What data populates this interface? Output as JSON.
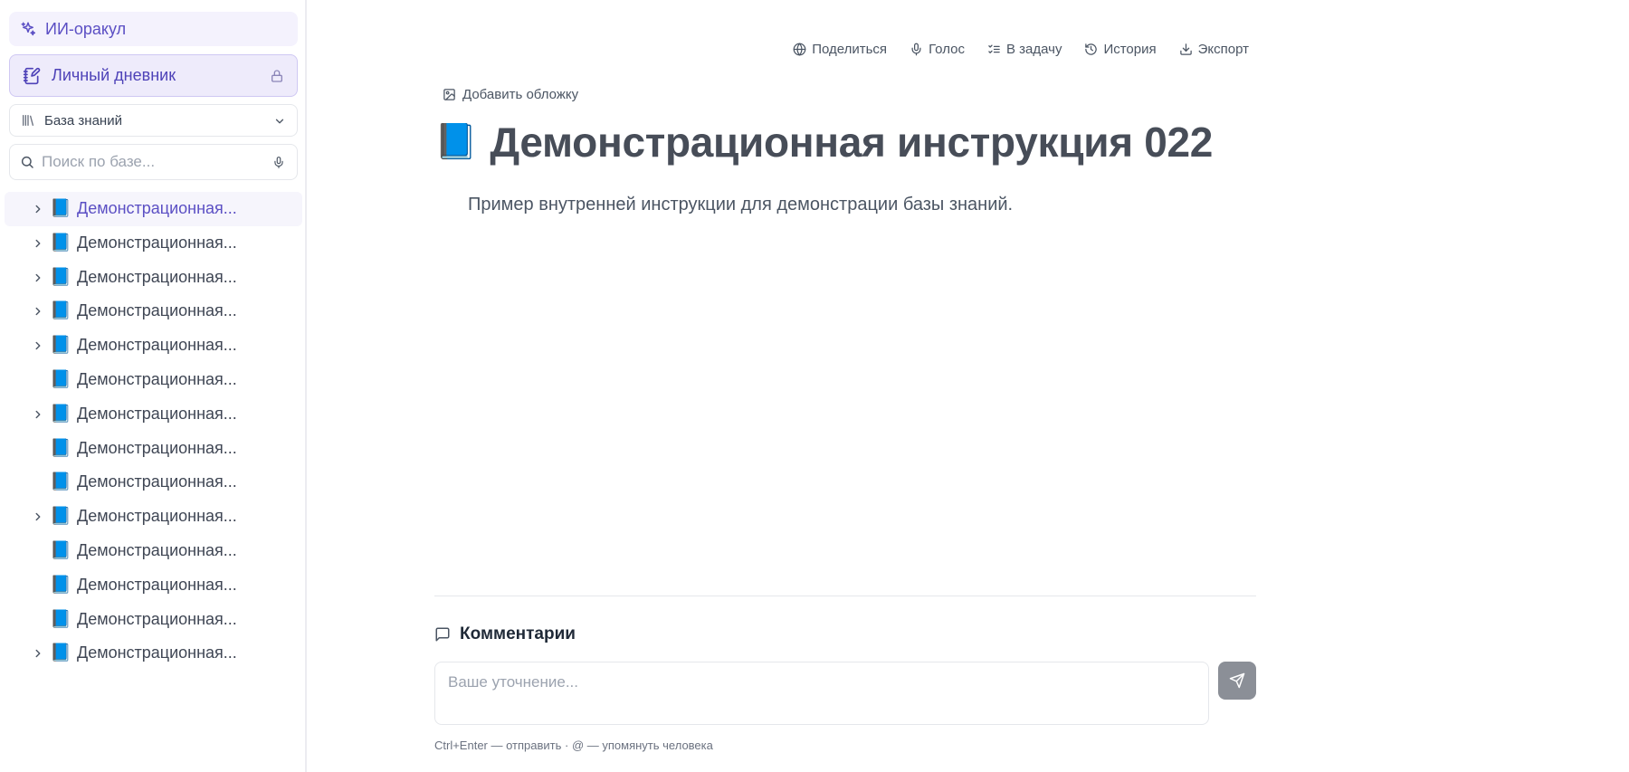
{
  "sidebar": {
    "oracle_label": "ИИ-оракул",
    "diary_label": "Личный дневник",
    "kb_select": "База знаний",
    "search_placeholder": "Поиск по базе...",
    "items": [
      {
        "label": "Демонстрационная...",
        "expandable": true,
        "active": true
      },
      {
        "label": "Демонстрационная...",
        "expandable": true
      },
      {
        "label": "Демонстрационная...",
        "expandable": true
      },
      {
        "label": "Демонстрационная...",
        "expandable": true
      },
      {
        "label": "Демонстрационная...",
        "expandable": true
      },
      {
        "label": "Демонстрационная...",
        "expandable": false
      },
      {
        "label": "Демонстрационная...",
        "expandable": true
      },
      {
        "label": "Демонстрационная...",
        "expandable": false
      },
      {
        "label": "Демонстрационная...",
        "expandable": false
      },
      {
        "label": "Демонстрационная...",
        "expandable": true
      },
      {
        "label": "Демонстрационная...",
        "expandable": false
      },
      {
        "label": "Демонстрационная...",
        "expandable": false
      },
      {
        "label": "Демонстрационная...",
        "expandable": false
      },
      {
        "label": "Демонстрационная...",
        "expandable": true
      }
    ],
    "item_icon": "📘"
  },
  "toolbar": {
    "share": "Поделиться",
    "voice": "Голос",
    "to_task": "В задачу",
    "history": "История",
    "export": "Экспорт"
  },
  "page": {
    "add_cover": "Добавить обложку",
    "icon": "📘",
    "title": "Демонстрационная инструкция 022",
    "body": "Пример внутренней инструкции для демонстрации базы знаний."
  },
  "comments": {
    "heading": "Комментарии",
    "placeholder": "Ваше уточнение...",
    "hint": "Ctrl+Enter — отправить · @ — упомянуть человека"
  },
  "colors": {
    "accent": "#5b4fc4",
    "diary_bg": "#eeebfb",
    "oracle_bg": "#f4f2fd",
    "send_button": "#8b8f97"
  }
}
